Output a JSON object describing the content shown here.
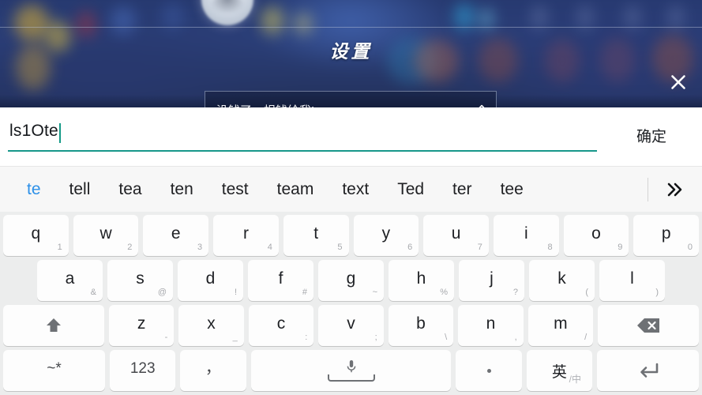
{
  "dialog": {
    "title": "设置",
    "close_label": "✕",
    "field_value": "没钱了，捐钱给我!",
    "edit_icon": "pencil-icon"
  },
  "editbar": {
    "text_value": "ls1Ote",
    "confirm_label": "确定",
    "caret_color": "#149a87",
    "underline_color": "#17978a"
  },
  "suggestions": {
    "items": [
      {
        "label": "te",
        "active": true
      },
      {
        "label": "tell",
        "active": false
      },
      {
        "label": "tea",
        "active": false
      },
      {
        "label": "ten",
        "active": false
      },
      {
        "label": "test",
        "active": false
      },
      {
        "label": "team",
        "active": false
      },
      {
        "label": "text",
        "active": false
      },
      {
        "label": "Ted",
        "active": false
      },
      {
        "label": "ter",
        "active": false
      },
      {
        "label": "tee",
        "active": false
      }
    ],
    "more_label": "»",
    "active_color": "#2d90e8"
  },
  "keyboard": {
    "row1": [
      {
        "main": "q",
        "alt": "1"
      },
      {
        "main": "w",
        "alt": "2"
      },
      {
        "main": "e",
        "alt": "3"
      },
      {
        "main": "r",
        "alt": "4"
      },
      {
        "main": "t",
        "alt": "5"
      },
      {
        "main": "y",
        "alt": "6"
      },
      {
        "main": "u",
        "alt": "7"
      },
      {
        "main": "i",
        "alt": "8"
      },
      {
        "main": "o",
        "alt": "9"
      },
      {
        "main": "p",
        "alt": "0"
      }
    ],
    "row2": [
      {
        "main": "a",
        "alt": "&"
      },
      {
        "main": "s",
        "alt": "@"
      },
      {
        "main": "d",
        "alt": "!"
      },
      {
        "main": "f",
        "alt": "#"
      },
      {
        "main": "g",
        "alt": "~"
      },
      {
        "main": "h",
        "alt": "%"
      },
      {
        "main": "j",
        "alt": "?"
      },
      {
        "main": "k",
        "alt": "("
      },
      {
        "main": "l",
        "alt": ")"
      }
    ],
    "row3": [
      {
        "main": "z",
        "alt": "-"
      },
      {
        "main": "x",
        "alt": "_"
      },
      {
        "main": "c",
        "alt": ":"
      },
      {
        "main": "v",
        "alt": ";"
      },
      {
        "main": "b",
        "alt": "\\"
      },
      {
        "main": "n",
        "alt": ","
      },
      {
        "main": "m",
        "alt": "/"
      }
    ],
    "shift_label": "shift-icon",
    "backspace_label": "backspace-icon",
    "symbols_label": "~*",
    "numbers_label": "123",
    "comma_label": "，",
    "space_label": "space-key",
    "period_label": "。",
    "lang_main": "英",
    "lang_alt": "/中",
    "enter_label": "enter-icon"
  }
}
